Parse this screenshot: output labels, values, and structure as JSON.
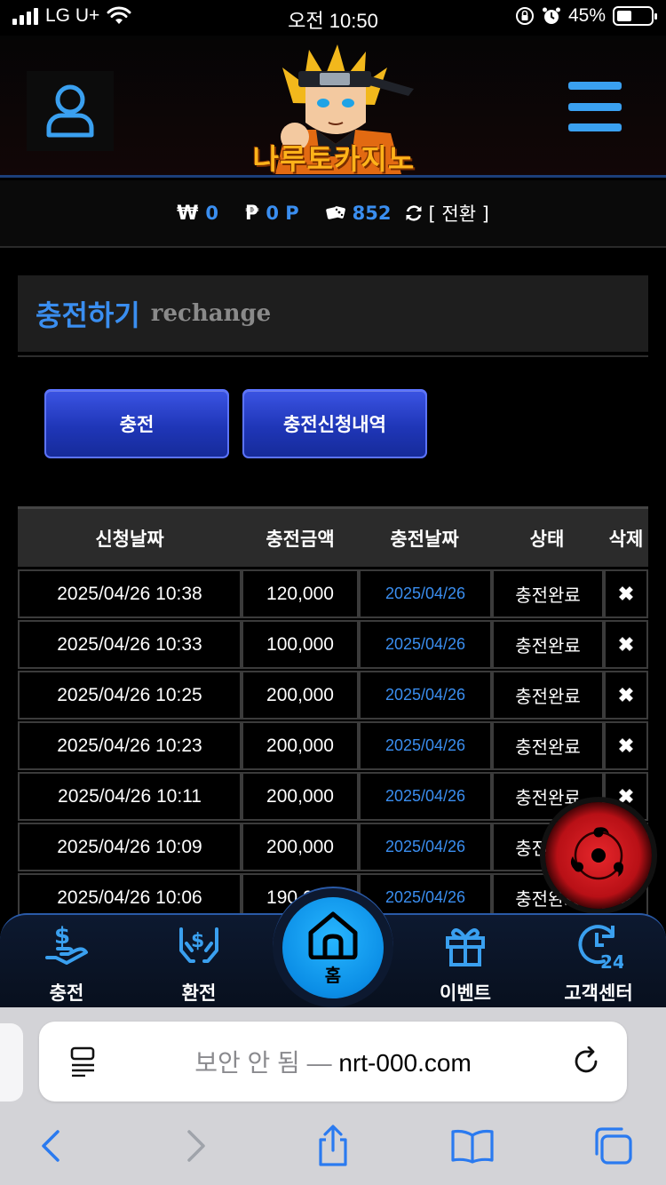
{
  "status_bar": {
    "carrier": "LG U+",
    "time": "오전 10:50",
    "battery": "45%"
  },
  "header": {
    "logo_text": "나루토카지노"
  },
  "balance": {
    "won_symbol": "₩",
    "won": "0",
    "point_symbol": "₱",
    "point": "0 P",
    "chips": "852",
    "switch_label": "[ 전환 ]"
  },
  "page": {
    "title": "충전하기",
    "subtitle": "rechange"
  },
  "buttons": {
    "charge": "충전",
    "history": "충전신청내역"
  },
  "table": {
    "headers": [
      "신청날짜",
      "충전금액",
      "충전날짜",
      "상태",
      "삭제"
    ],
    "rows": [
      {
        "requested": "2025/04/26 10:38",
        "amount": "120,000",
        "charged": "2025/04/26",
        "status": "충전완료",
        "delete": "✖"
      },
      {
        "requested": "2025/04/26 10:33",
        "amount": "100,000",
        "charged": "2025/04/26",
        "status": "충전완료",
        "delete": "✖"
      },
      {
        "requested": "2025/04/26 10:25",
        "amount": "200,000",
        "charged": "2025/04/26",
        "status": "충전완료",
        "delete": "✖"
      },
      {
        "requested": "2025/04/26 10:23",
        "amount": "200,000",
        "charged": "2025/04/26",
        "status": "충전완료",
        "delete": "✖"
      },
      {
        "requested": "2025/04/26 10:11",
        "amount": "200,000",
        "charged": "2025/04/26",
        "status": "충전완료",
        "delete": "✖"
      },
      {
        "requested": "2025/04/26 10:09",
        "amount": "200,000",
        "charged": "2025/04/26",
        "status": "충전완료",
        "delete": "✖"
      },
      {
        "requested": "2025/04/26 10:06",
        "amount": "190,000",
        "charged": "2025/04/26",
        "status": "충전완료",
        "delete": "✖"
      }
    ]
  },
  "bottom_nav": {
    "charge": "충전",
    "exchange": "환전",
    "home": "홈",
    "event": "이벤트",
    "support": "고객센터"
  },
  "browser": {
    "security": "보안 안 됨 — ",
    "host": "nrt-000.com"
  },
  "colors": {
    "accent": "#3a8ef0",
    "button": "#2a42cc",
    "home": "#0b8ee6",
    "fab": "#c8161c"
  }
}
